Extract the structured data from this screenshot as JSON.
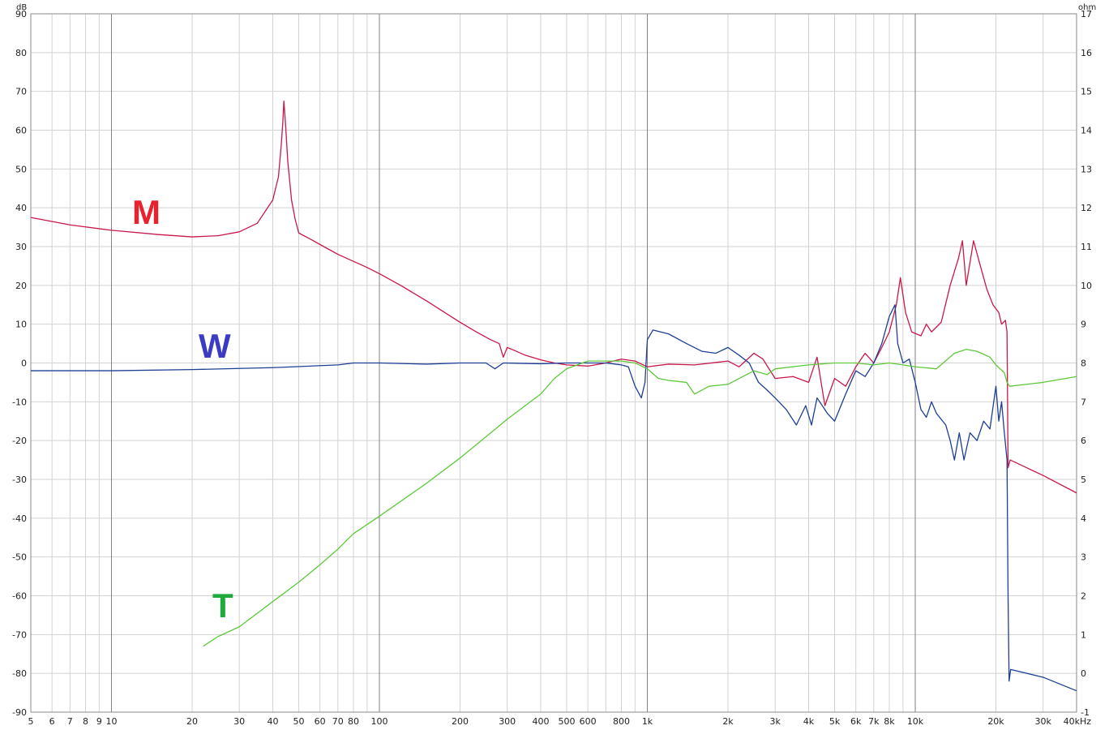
{
  "chart_data": {
    "type": "line",
    "x_scale": "log",
    "xlim": [
      5,
      40000
    ],
    "ylim": [
      -90,
      90
    ],
    "y2lim": [
      -1,
      17
    ],
    "grid": true,
    "y_unit": "dB",
    "y2_unit": "ohm",
    "x_tick_labels": [
      {
        "value": 5,
        "label": "5"
      },
      {
        "value": 6,
        "label": "6"
      },
      {
        "value": 7,
        "label": "7"
      },
      {
        "value": 8,
        "label": "8"
      },
      {
        "value": 9,
        "label": "9"
      },
      {
        "value": 10,
        "label": "10"
      },
      {
        "value": 20,
        "label": "20"
      },
      {
        "value": 30,
        "label": "30"
      },
      {
        "value": 40,
        "label": "40"
      },
      {
        "value": 50,
        "label": "50"
      },
      {
        "value": 60,
        "label": "60"
      },
      {
        "value": 70,
        "label": "70"
      },
      {
        "value": 80,
        "label": "80"
      },
      {
        "value": 100,
        "label": "100"
      },
      {
        "value": 200,
        "label": "200"
      },
      {
        "value": 300,
        "label": "300"
      },
      {
        "value": 400,
        "label": "400"
      },
      {
        "value": 500,
        "label": "500"
      },
      {
        "value": 600,
        "label": "600"
      },
      {
        "value": 800,
        "label": "800"
      },
      {
        "value": 1000,
        "label": "1k"
      },
      {
        "value": 2000,
        "label": "2k"
      },
      {
        "value": 3000,
        "label": "3k"
      },
      {
        "value": 4000,
        "label": "4k"
      },
      {
        "value": 5000,
        "label": "5k"
      },
      {
        "value": 6000,
        "label": "6k"
      },
      {
        "value": 7000,
        "label": "7k"
      },
      {
        "value": 8000,
        "label": "8k"
      },
      {
        "value": 10000,
        "label": "10k"
      },
      {
        "value": 20000,
        "label": "20k"
      },
      {
        "value": 30000,
        "label": "30k"
      },
      {
        "value": 40000,
        "label": "40kHz"
      }
    ],
    "y_tick_labels": [
      "90",
      "80",
      "70",
      "60",
      "50",
      "40",
      "30",
      "20",
      "10",
      "0",
      "-10",
      "-20",
      "-30",
      "-40",
      "-50",
      "-60",
      "-70",
      "-80",
      "-90"
    ],
    "y2_tick_labels": [
      "17",
      "16",
      "15",
      "14",
      "13",
      "12",
      "11",
      "10",
      "9",
      "8",
      "7",
      "6",
      "5",
      "4",
      "3",
      "2",
      "1",
      "0",
      "-1"
    ],
    "series": [
      {
        "name": "M",
        "label_color": "#e8232e",
        "color": "#c8184a",
        "axis": "left",
        "points": [
          [
            5,
            37.5
          ],
          [
            7,
            35.6
          ],
          [
            10,
            34.2
          ],
          [
            15,
            33.1
          ],
          [
            20,
            32.5
          ],
          [
            25,
            32.8
          ],
          [
            30,
            33.8
          ],
          [
            35,
            36.0
          ],
          [
            40,
            42.0
          ],
          [
            42,
            48.0
          ],
          [
            43,
            56.0
          ],
          [
            43.6,
            62.0
          ],
          [
            44,
            67.5
          ],
          [
            44.6,
            62.0
          ],
          [
            45.5,
            52.0
          ],
          [
            47,
            42.0
          ],
          [
            48.5,
            37.0
          ],
          [
            50,
            33.5
          ],
          [
            55,
            32.0
          ],
          [
            62,
            30.0
          ],
          [
            70,
            28.0
          ],
          [
            80,
            26.2
          ],
          [
            90,
            24.6
          ],
          [
            100,
            23.0
          ],
          [
            120,
            20.0
          ],
          [
            150,
            16.0
          ],
          [
            180,
            12.5
          ],
          [
            200,
            10.5
          ],
          [
            230,
            8.0
          ],
          [
            260,
            6.0
          ],
          [
            280,
            5.0
          ],
          [
            290,
            1.5
          ],
          [
            300,
            4.0
          ],
          [
            320,
            3.2
          ],
          [
            350,
            2.0
          ],
          [
            400,
            0.8
          ],
          [
            450,
            0.0
          ],
          [
            500,
            -0.5
          ],
          [
            600,
            -0.8
          ],
          [
            700,
            0.0
          ],
          [
            800,
            1.0
          ],
          [
            900,
            0.5
          ],
          [
            1000,
            -1.0
          ],
          [
            1200,
            -0.3
          ],
          [
            1500,
            -0.5
          ],
          [
            2000,
            0.5
          ],
          [
            2200,
            -1.0
          ],
          [
            2500,
            2.5
          ],
          [
            2700,
            1.0
          ],
          [
            3000,
            -4.0
          ],
          [
            3500,
            -3.5
          ],
          [
            4000,
            -5.0
          ],
          [
            4300,
            1.5
          ],
          [
            4600,
            -11.0
          ],
          [
            5000,
            -4.0
          ],
          [
            5500,
            -6.0
          ],
          [
            6000,
            -1.0
          ],
          [
            6500,
            2.5
          ],
          [
            7000,
            0.0
          ],
          [
            7500,
            4.0
          ],
          [
            8000,
            8.0
          ],
          [
            8500,
            15.0
          ],
          [
            8800,
            22.0
          ],
          [
            9200,
            13.0
          ],
          [
            9700,
            8.0
          ],
          [
            10500,
            7.0
          ],
          [
            11000,
            10.0
          ],
          [
            11500,
            8.0
          ],
          [
            12500,
            10.5
          ],
          [
            13500,
            20.0
          ],
          [
            14500,
            27.0
          ],
          [
            15000,
            31.5
          ],
          [
            15500,
            20.0
          ],
          [
            16500,
            31.5
          ],
          [
            17500,
            25.0
          ],
          [
            18500,
            19.0
          ],
          [
            19500,
            15.0
          ],
          [
            20500,
            13.0
          ],
          [
            21000,
            10.0
          ],
          [
            21700,
            11.0
          ],
          [
            22000,
            8.0
          ],
          [
            22200,
            -27.0
          ],
          [
            22600,
            -25.0
          ],
          [
            30000,
            -29.0
          ],
          [
            40000,
            -33.5
          ]
        ]
      },
      {
        "name": "W",
        "label_color": "#3b3bc4",
        "color": "#1c3f94",
        "axis": "left",
        "points": [
          [
            5,
            -2.0
          ],
          [
            10,
            -2.0
          ],
          [
            20,
            -1.7
          ],
          [
            40,
            -1.2
          ],
          [
            70,
            -0.5
          ],
          [
            80,
            0.0
          ],
          [
            100,
            0.0
          ],
          [
            150,
            -0.3
          ],
          [
            200,
            0.0
          ],
          [
            250,
            0.0
          ],
          [
            270,
            -1.5
          ],
          [
            290,
            0.0
          ],
          [
            400,
            -0.2
          ],
          [
            500,
            0.0
          ],
          [
            700,
            0.0
          ],
          [
            800,
            -0.5
          ],
          [
            850,
            -1.0
          ],
          [
            900,
            -6.0
          ],
          [
            950,
            -9.0
          ],
          [
            980,
            -5.0
          ],
          [
            1000,
            6.0
          ],
          [
            1050,
            8.5
          ],
          [
            1200,
            7.5
          ],
          [
            1400,
            5.0
          ],
          [
            1600,
            3.0
          ],
          [
            1800,
            2.5
          ],
          [
            2000,
            4.0
          ],
          [
            2200,
            2.0
          ],
          [
            2400,
            0.0
          ],
          [
            2600,
            -5.0
          ],
          [
            2800,
            -7.0
          ],
          [
            3000,
            -9.0
          ],
          [
            3300,
            -12.0
          ],
          [
            3600,
            -16.0
          ],
          [
            3900,
            -11.0
          ],
          [
            4100,
            -16.0
          ],
          [
            4300,
            -9.0
          ],
          [
            4700,
            -13.0
          ],
          [
            5000,
            -15.0
          ],
          [
            5500,
            -8.0
          ],
          [
            6000,
            -2.0
          ],
          [
            6500,
            -3.5
          ],
          [
            7000,
            0.0
          ],
          [
            7500,
            5.0
          ],
          [
            8000,
            12.0
          ],
          [
            8400,
            15.0
          ],
          [
            8600,
            5.0
          ],
          [
            9000,
            0.0
          ],
          [
            9500,
            1.0
          ],
          [
            10000,
            -5.0
          ],
          [
            10500,
            -12.0
          ],
          [
            11000,
            -14.0
          ],
          [
            11500,
            -10.0
          ],
          [
            12000,
            -13.0
          ],
          [
            13000,
            -16.0
          ],
          [
            13500,
            -20.0
          ],
          [
            14000,
            -25.0
          ],
          [
            14600,
            -18.0
          ],
          [
            15200,
            -25.0
          ],
          [
            16000,
            -18.0
          ],
          [
            17000,
            -20.0
          ],
          [
            18000,
            -15.0
          ],
          [
            19000,
            -17.0
          ],
          [
            20000,
            -6.0
          ],
          [
            20500,
            -15.0
          ],
          [
            21000,
            -10.0
          ],
          [
            21500,
            -18.0
          ],
          [
            22000,
            -25.0
          ],
          [
            22200,
            -60.0
          ],
          [
            22400,
            -82.0
          ],
          [
            22700,
            -79.0
          ],
          [
            30000,
            -81.0
          ],
          [
            40000,
            -84.5
          ]
        ]
      },
      {
        "name": "T",
        "label_color": "#1faa3c",
        "color": "#5dc93a",
        "axis": "left",
        "points": [
          [
            22,
            -73.0
          ],
          [
            25,
            -70.5
          ],
          [
            30,
            -68.0
          ],
          [
            40,
            -61.5
          ],
          [
            50,
            -56.5
          ],
          [
            60,
            -52.0
          ],
          [
            70,
            -48.0
          ],
          [
            80,
            -44.0
          ],
          [
            100,
            -39.5
          ],
          [
            150,
            -31.0
          ],
          [
            200,
            -24.5
          ],
          [
            250,
            -19.0
          ],
          [
            300,
            -14.5
          ],
          [
            400,
            -8.0
          ],
          [
            450,
            -4.0
          ],
          [
            500,
            -1.5
          ],
          [
            600,
            0.5
          ],
          [
            700,
            0.5
          ],
          [
            800,
            0.5
          ],
          [
            900,
            0.0
          ],
          [
            1000,
            -1.5
          ],
          [
            1100,
            -4.0
          ],
          [
            1200,
            -4.5
          ],
          [
            1400,
            -5.0
          ],
          [
            1500,
            -8.0
          ],
          [
            1700,
            -6.0
          ],
          [
            2000,
            -5.5
          ],
          [
            2500,
            -2.0
          ],
          [
            2800,
            -3.0
          ],
          [
            3000,
            -1.5
          ],
          [
            4000,
            -0.5
          ],
          [
            5000,
            0.0
          ],
          [
            6000,
            0.0
          ],
          [
            7000,
            -0.5
          ],
          [
            8000,
            0.0
          ],
          [
            9000,
            -0.5
          ],
          [
            10000,
            -1.0
          ],
          [
            12000,
            -1.5
          ],
          [
            14000,
            2.5
          ],
          [
            15500,
            3.5
          ],
          [
            17000,
            3.0
          ],
          [
            19000,
            1.5
          ],
          [
            20000,
            -0.5
          ],
          [
            21500,
            -2.5
          ],
          [
            22000,
            -5.0
          ],
          [
            22500,
            -6.0
          ],
          [
            30000,
            -5.0
          ],
          [
            40000,
            -3.5
          ]
        ]
      }
    ]
  }
}
